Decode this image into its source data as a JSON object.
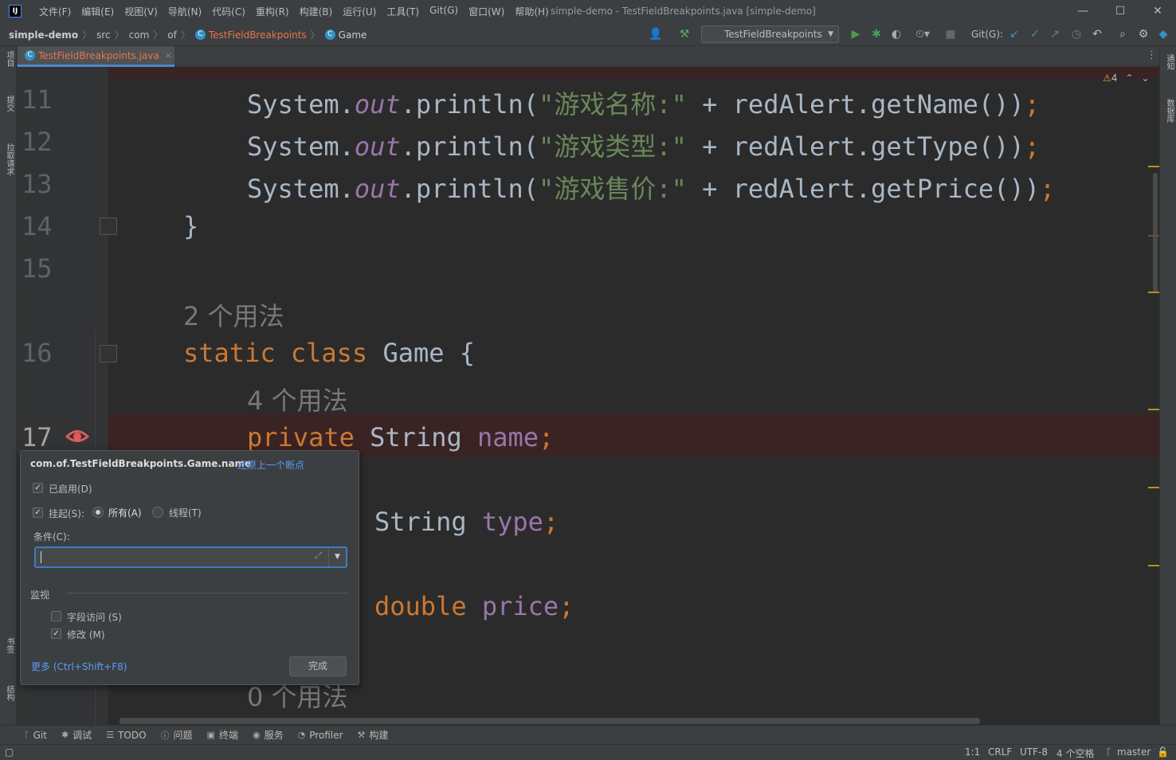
{
  "titlebar": {
    "logo": "IJ",
    "menu": [
      "文件(F)",
      "编辑(E)",
      "视图(V)",
      "导航(N)",
      "代码(C)",
      "重构(R)",
      "构建(B)",
      "运行(U)",
      "工具(T)",
      "Git(G)",
      "窗口(W)",
      "帮助(H)"
    ],
    "title": "simple-demo - TestFieldBreakpoints.java [simple-demo]",
    "minimize": "—",
    "maximize": "☐",
    "close": "✕"
  },
  "navbar": {
    "crumbs": [
      "simple-demo",
      "src",
      "com",
      "of",
      "TestFieldBreakpoints",
      "Game"
    ],
    "run_config": "TestFieldBreakpoints",
    "git_label": "Git(G):"
  },
  "left_tools": [
    "项目",
    "提交",
    "拉取请求",
    "书签",
    "结构"
  ],
  "right_tools": [
    "通知",
    "数据库"
  ],
  "tab": {
    "file": "TestFieldBreakpoints.java",
    "close": "×"
  },
  "editor": {
    "warning_count": "4",
    "lines": [
      {
        "num": "11",
        "code": "System.out.println(\"游戏名称:\" + redAlert.getName());"
      },
      {
        "num": "12",
        "code": "System.out.println(\"游戏类型:\" + redAlert.getType());"
      },
      {
        "num": "13",
        "code": "System.out.println(\"游戏售价:\" + redAlert.getPrice());"
      },
      {
        "num": "14",
        "code": "}"
      },
      {
        "num": "15",
        "code": ""
      },
      {
        "num": "16",
        "code": "static class Game {"
      },
      {
        "num": "17",
        "code": "private String name;"
      }
    ],
    "hints": [
      "2 个用法",
      "4 个用法",
      "0 个用法"
    ],
    "code_type": "String type;",
    "code_price": "double price;"
  },
  "popup": {
    "title": "com.of.TestFieldBreakpoints.Game.name",
    "restore_link": "还原上一个断点",
    "enabled_label": "已启用(D)",
    "suspend_label": "挂起(S):",
    "all_label": "所有(A)",
    "thread_label": "线程(T)",
    "condition_label": "条件(C):",
    "condition_value": "",
    "watch_label": "监视",
    "field_access_label": "字段访问 (S)",
    "modification_label": "修改 (M)",
    "more_link": "更多 (Ctrl+Shift+F8)",
    "done_button": "完成",
    "enabled_checked": true,
    "suspend_checked": true,
    "field_access_checked": false,
    "modification_checked": true
  },
  "bottom_tools": [
    {
      "icon": "git-icon",
      "label": "Git"
    },
    {
      "icon": "debug-icon",
      "label": "调试"
    },
    {
      "icon": "todo-icon",
      "label": "TODO"
    },
    {
      "icon": "problems-icon",
      "label": "问题"
    },
    {
      "icon": "terminal-icon",
      "label": "终端"
    },
    {
      "icon": "services-icon",
      "label": "服务"
    },
    {
      "icon": "profiler-icon",
      "label": "Profiler"
    },
    {
      "icon": "build-icon",
      "label": "构建"
    }
  ],
  "status": {
    "position": "1:1",
    "line_sep": "CRLF",
    "encoding": "UTF-8",
    "indent": "4 个空格",
    "branch": "master"
  },
  "colors": {
    "keyword": "#cc7832",
    "string": "#6a8759",
    "field": "#9876aa",
    "breakpoint_line": "#3a2323",
    "link": "#589df6"
  }
}
